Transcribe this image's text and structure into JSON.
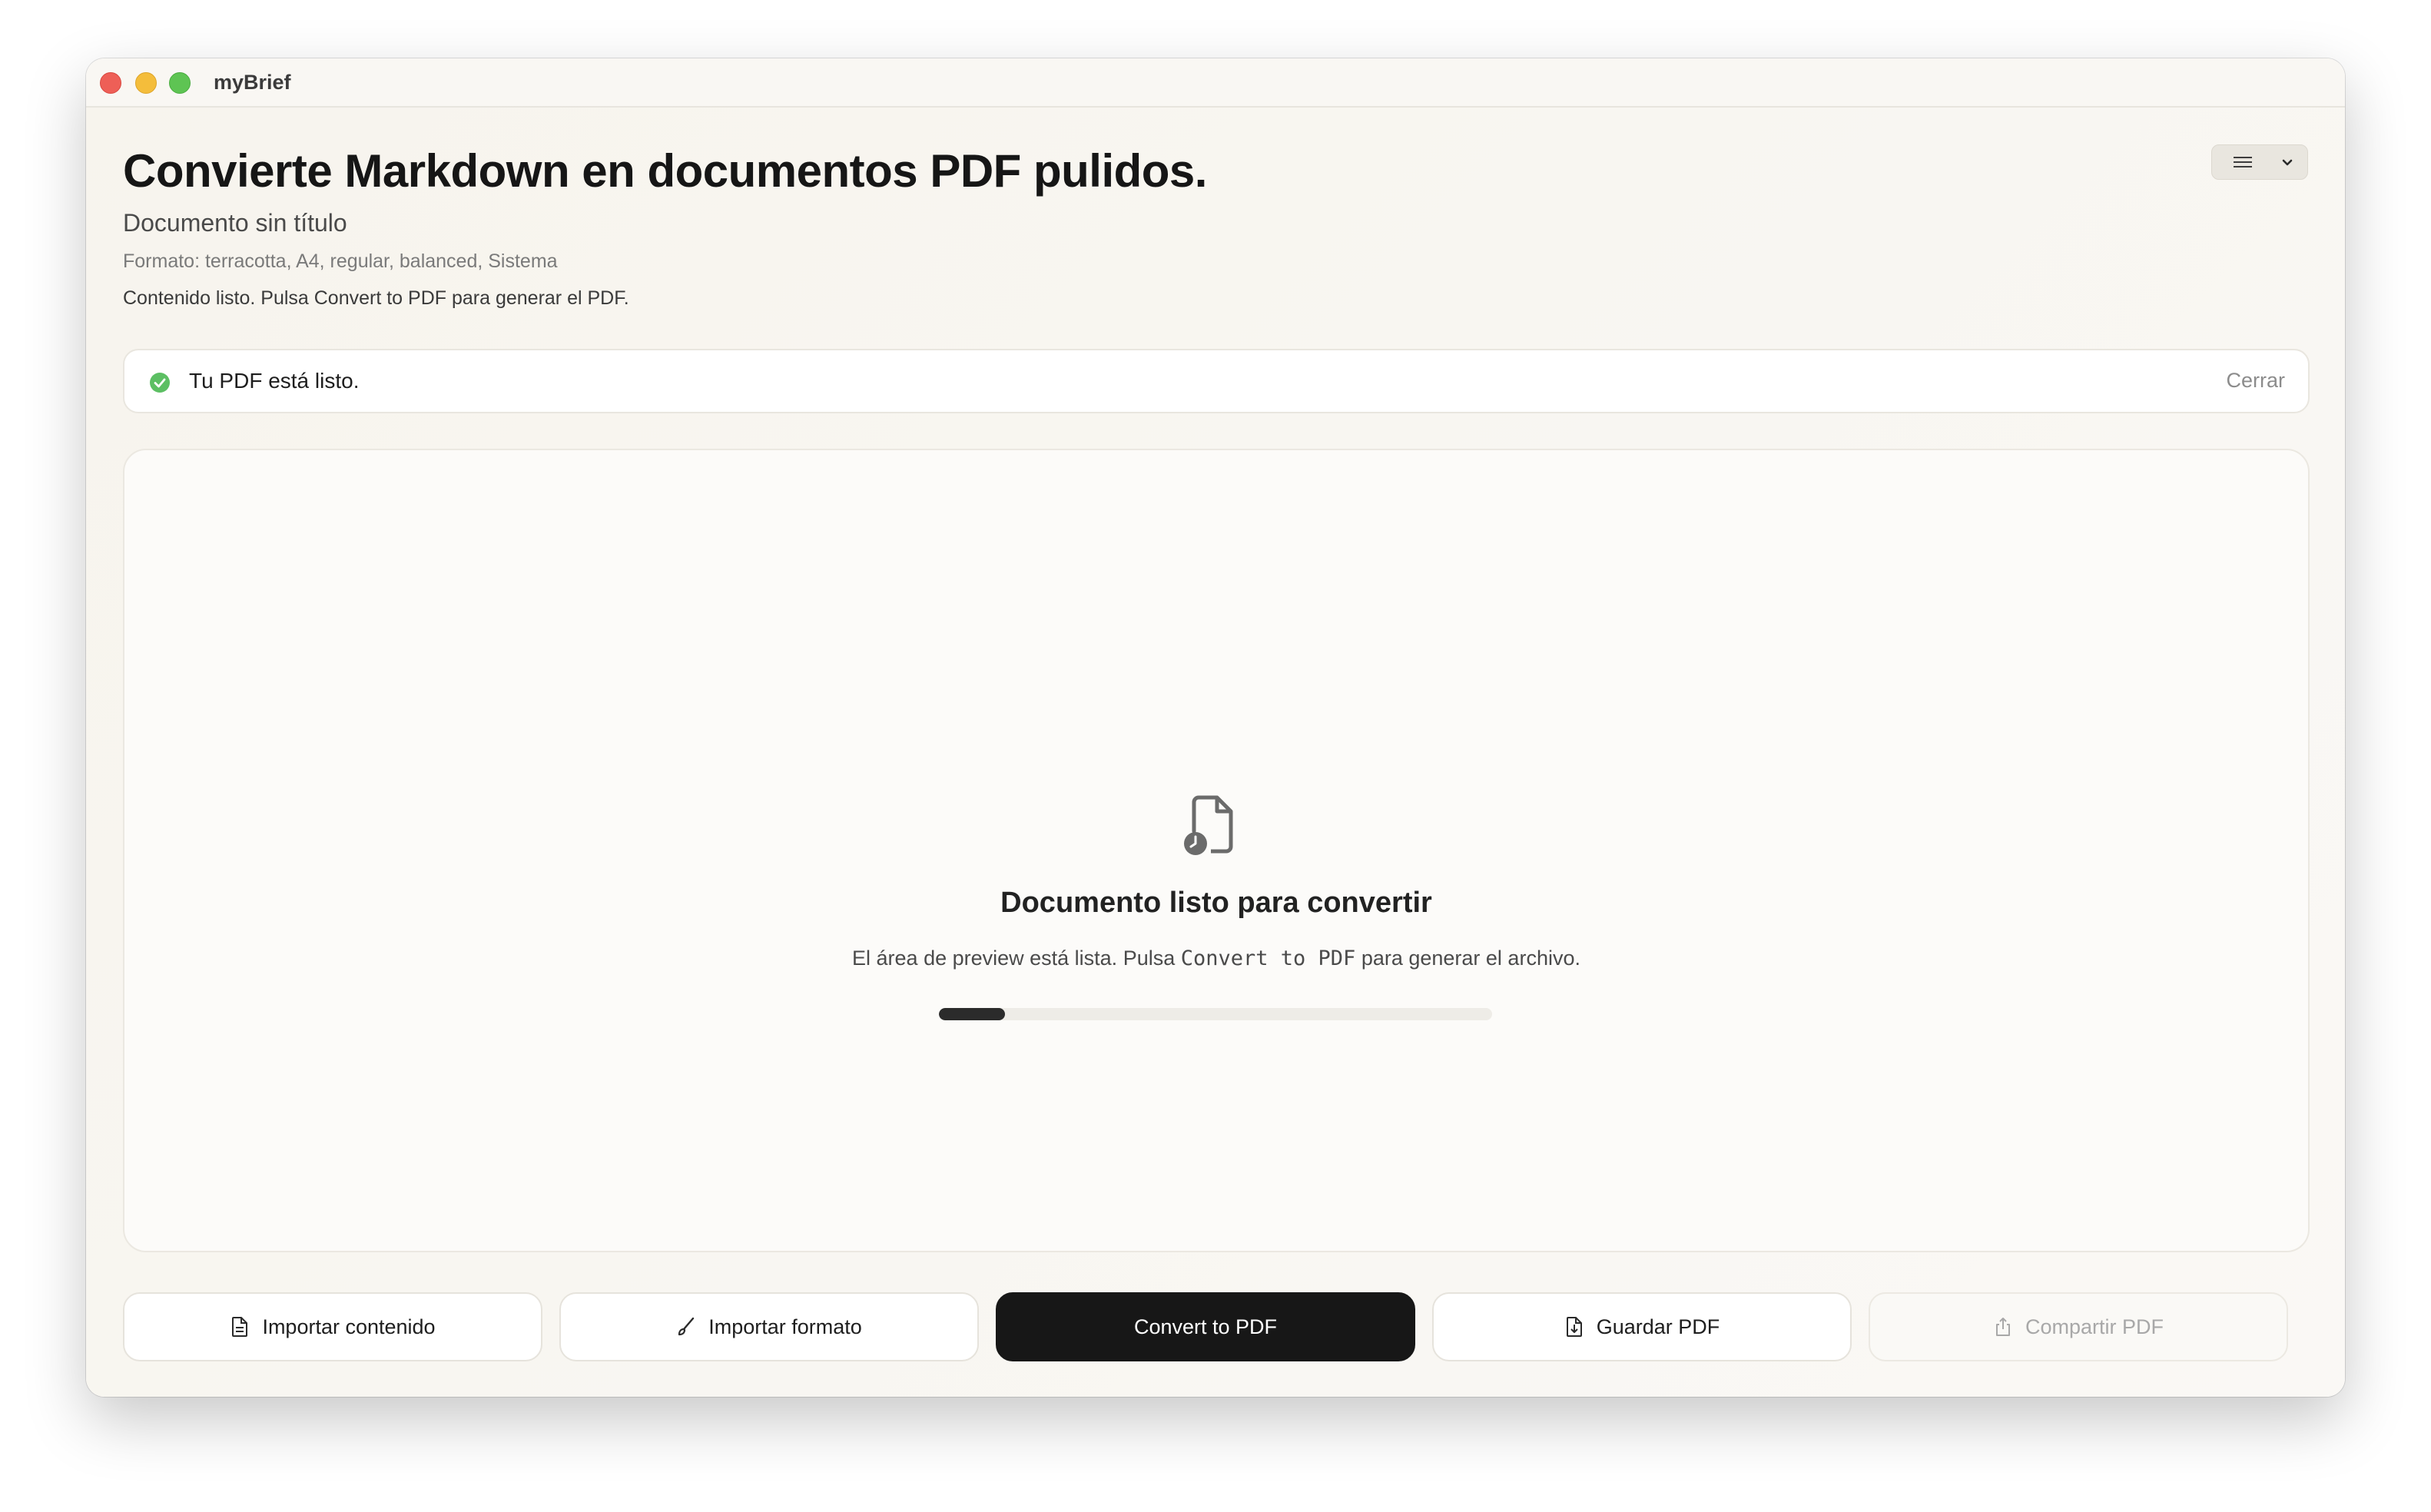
{
  "window": {
    "app_name": "myBrief"
  },
  "header": {
    "headline": "Convierte Markdown en documentos PDF pulidos.",
    "document_title": "Documento sin título",
    "format_line": "Formato: terracotta, A4, regular, balanced, Sistema",
    "status_line": "Contenido listo. Pulsa Convert to PDF para generar el PDF."
  },
  "banner": {
    "message": "Tu PDF está listo.",
    "close_label": "Cerrar",
    "status_color": "#5cbf63"
  },
  "preview": {
    "title": "Documento listo para convertir",
    "subtitle_before": "El área de preview está lista. Pulsa ",
    "subtitle_code": "Convert to PDF",
    "subtitle_after": " para generar el archivo.",
    "progress_fraction": 0.12
  },
  "actions": {
    "import_content": "Importar contenido",
    "import_format": "Importar formato",
    "convert": "Convert to PDF",
    "save_pdf": "Guardar PDF",
    "share_pdf": "Compartir PDF"
  },
  "icons": {
    "menu": "list-lines-icon",
    "chevron": "chevron-down-icon",
    "status": "check-circle-icon",
    "document": "document-clock-icon",
    "import_content": "document-icon",
    "import_format": "brush-icon",
    "save": "document-download-icon",
    "share": "share-icon"
  }
}
